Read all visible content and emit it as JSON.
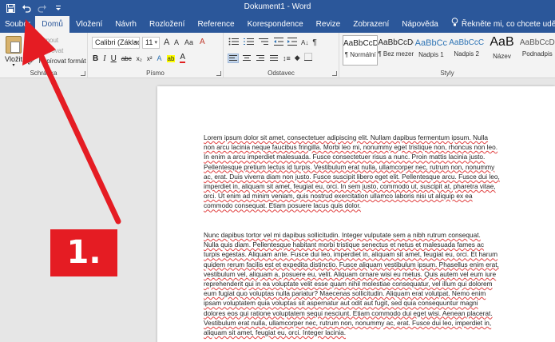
{
  "window": {
    "title": "Dokument1 - Word"
  },
  "qat": {
    "save_icon": "save-icon",
    "undo_icon": "undo-icon",
    "redo_icon": "redo-icon",
    "customize_icon": "customize-icon"
  },
  "tabs": [
    {
      "label": "Soubor"
    },
    {
      "label": "Domů"
    },
    {
      "label": "Vložení"
    },
    {
      "label": "Návrh"
    },
    {
      "label": "Rozložení"
    },
    {
      "label": "Reference"
    },
    {
      "label": "Korespondence"
    },
    {
      "label": "Revize"
    },
    {
      "label": "Zobrazení"
    },
    {
      "label": "Nápověda"
    },
    {
      "label": "Řekněte mi, co chcete udělat"
    }
  ],
  "ribbon": {
    "clipboard": {
      "group_label": "Schránka",
      "paste_label": "Vložit",
      "cut_label": "Vyjmout",
      "copy_label": "Kopírovat",
      "format_painter_label": "Kopírovat formát"
    },
    "font": {
      "group_label": "Písmo",
      "font_name": "Calibri (Základ",
      "font_size": "11",
      "bold": "B",
      "italic": "I",
      "underline": "U",
      "strike": "abc",
      "subscript": "x₂",
      "superscript": "x²",
      "grow": "A",
      "shrink": "A",
      "case": "Aa",
      "clear": "A",
      "highlight": "ab",
      "color": "A"
    },
    "paragraph": {
      "group_label": "Odstavec",
      "pilcrow": "¶"
    },
    "styles": {
      "group_label": "Styly",
      "items": [
        {
          "sample": "AaBbCcDc",
          "name": "¶ Normální"
        },
        {
          "sample": "AaBbCcDc",
          "name": "¶ Bez mezer"
        },
        {
          "sample": "AaBbCc",
          "name": "Nadpis 1"
        },
        {
          "sample": "AaBbCcC",
          "name": "Nadpis 2"
        },
        {
          "sample": "AaB",
          "name": "Název"
        },
        {
          "sample": "AaBbCcD",
          "name": "Podnadpis"
        }
      ]
    }
  },
  "document": {
    "paragraph1": [
      "Lorem ipsum dolor sit amet, consectetuer adipiscing elit. Nullam dapibus fermentum ipsum. Nulla",
      "non arcu lacinia neque faucibus fringilla. Morbi leo mi, nonummy eget tristique non, rhoncus non leo.",
      "In enim a arcu imperdiet malesuada. Fusce consectetuer risus a nunc. Proin mattis lacinia justo.",
      "Pellentesque pretium lectus id turpis. Vestibulum erat nulla, ullamcorper nec, rutrum non, nonummy",
      "ac, erat. Duis viverra diam non justo. Fusce suscipit libero eget elit. Pellentesque arcu. Fusce dui leo,",
      "imperdiet in, aliquam sit amet, feugiat eu, orci. In sem justo, commodo ut, suscipit at, pharetra vitae,",
      "orci. Ut enim ad minim veniam, quis nostrud exercitation ullamco laboris nisi ut aliquip ex ea",
      "commodo consequat. Etiam posuere lacus quis dolor."
    ],
    "paragraph2": [
      "Nunc dapibus tortor vel mi dapibus sollicitudin. Integer vulputate sem a nibh rutrum consequat.",
      "Nulla quis diam. Pellentesque habitant morbi tristique senectus et netus et malesuada fames ac",
      "turpis egestas. Aliquam ante. Fusce dui leo, imperdiet in, aliquam sit amet, feugiat eu, orci. Et harum",
      "quidem rerum facilis est et expedita distinctio. Fusce aliquam vestibulum ipsum. Phasellus enim erat,",
      "vestibulum vel, aliquam a, posuere eu, velit. Aliquam ornare wisi eu metus. Quis autem vel eum iure",
      "reprehenderit qui in ea voluptate velit esse quam nihil molestiae consequatur, vel illum qui dolorem",
      "eum fugiat quo voluptas nulla pariatur? Maecenas sollicitudin. Aliquam erat volutpat. Nemo enim",
      "ipsam voluptatem quia voluptas sit aspernatur aut odit aut fugit, sed quia consequuntur magni",
      "dolores eos qui ratione voluptatem sequi nesciunt. Etiam commodo dui eget wisi. Aenean placerat.",
      "Vestibulum erat nulla, ullamcorper nec, rutrum non, nonummy ac, erat. Fusce dui leo, imperdiet in,",
      "aliquam sit amet, feugiat eu, orci. Integer lacinia."
    ]
  },
  "annotation": {
    "step_label": "1.",
    "arrow_color": "#e51c23"
  },
  "colors": {
    "word_blue": "#2b579a",
    "ribbon_bg": "#f3f3f3",
    "heading_blue": "#2e74b5"
  }
}
